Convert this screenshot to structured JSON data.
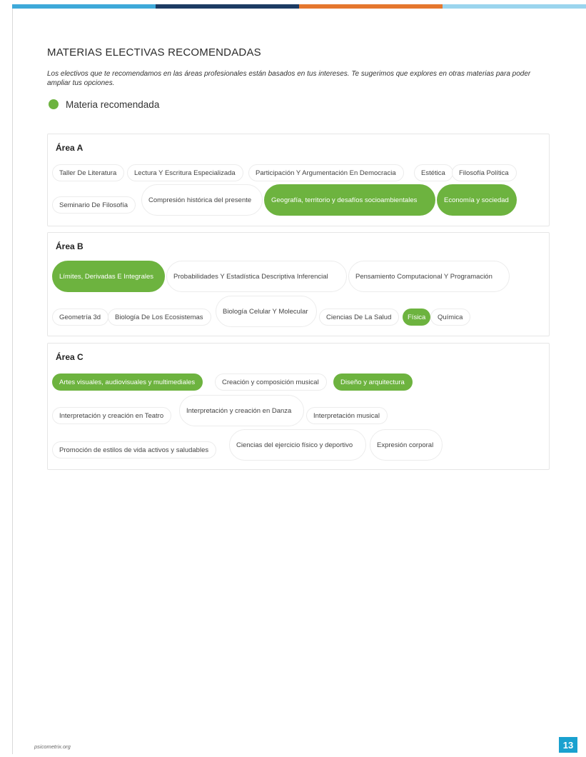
{
  "colors": {
    "recommended": "#6db33f",
    "topbar": [
      "#3ea9d9",
      "#1c3b63",
      "#e5772e",
      "#9bd5ee"
    ],
    "page_number_bg": "#1aa1cf"
  },
  "header": {
    "title": "MATERIAS ELECTIVAS RECOMENDADAS",
    "intro": "Los electivos que te recomendamos en las áreas profesionales están basados en tus intereses. Te sugerimos que explores en otras materias para poder ampliar tus opciones."
  },
  "legend": {
    "label": "Materia recomendada"
  },
  "areas": [
    {
      "title": "Área A",
      "subjects": [
        {
          "label": "Taller De Literatura",
          "recommended": false
        },
        {
          "label": "Lectura Y Escritura Especializada",
          "recommended": false
        },
        {
          "label": "Participación Y Argumentación En Democracia",
          "recommended": false
        },
        {
          "label": "Estética",
          "recommended": false
        },
        {
          "label": "Filosofía Política",
          "recommended": false
        },
        {
          "label": "Seminario De Filosofía",
          "recommended": false
        },
        {
          "label": "Compresión histórica del presente",
          "recommended": false
        },
        {
          "label": "Geografía, territorio y desafíos socioambientales",
          "recommended": true
        },
        {
          "label": "Economía y sociedad",
          "recommended": true
        }
      ]
    },
    {
      "title": "Área B",
      "subjects": [
        {
          "label": "Límites, Derivadas E Integrales",
          "recommended": true
        },
        {
          "label": "Probabilidades Y Estadística Descriptiva Inferencial",
          "recommended": false
        },
        {
          "label": "Pensamiento Computacional Y Programación",
          "recommended": false
        },
        {
          "label": "Geometría 3d",
          "recommended": false
        },
        {
          "label": "Biología De Los Ecosistemas",
          "recommended": false
        },
        {
          "label": "Biología Celular Y Molecular",
          "recommended": false
        },
        {
          "label": "Ciencias De La Salud",
          "recommended": false
        },
        {
          "label": "Física",
          "recommended": true
        },
        {
          "label": "Química",
          "recommended": false
        }
      ]
    },
    {
      "title": "Área C",
      "subjects": [
        {
          "label": "Artes visuales, audiovisuales y multimediales",
          "recommended": true
        },
        {
          "label": "Creación y composición musical",
          "recommended": false
        },
        {
          "label": "Diseño y arquitectura",
          "recommended": true
        },
        {
          "label": "Interpretación y creación en Teatro",
          "recommended": false
        },
        {
          "label": "Interpretación y creación en Danza",
          "recommended": false
        },
        {
          "label": "Interpretación musical",
          "recommended": false
        },
        {
          "label": "Promoción de estilos de vida activos y saludables",
          "recommended": false
        },
        {
          "label": "Ciencias del ejercicio físico y deportivo",
          "recommended": false
        },
        {
          "label": "Expresión corporal",
          "recommended": false
        }
      ]
    }
  ],
  "footer": {
    "url": "psicometrix.org",
    "page_number": "13"
  }
}
